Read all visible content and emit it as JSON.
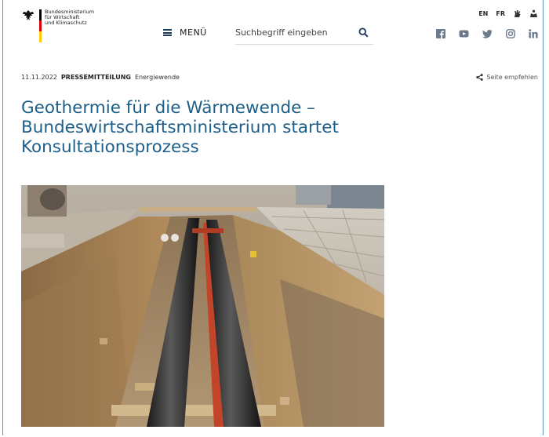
{
  "header": {
    "ministry_lines": [
      "Bundesministerium",
      "für Wirtschaft",
      "und Klimaschutz"
    ],
    "menu_label": "MENÜ",
    "search_placeholder": "Suchbegriff eingeben",
    "languages": [
      "EN",
      "FR"
    ],
    "accessibility_icons": [
      "sign-language-icon",
      "easy-language-icon"
    ],
    "social_icons": [
      "facebook-icon",
      "youtube-icon",
      "twitter-icon",
      "instagram-icon",
      "linkedin-icon"
    ]
  },
  "article": {
    "date": "11.11.2022",
    "type": "PRESSEMITTEILUNG",
    "category": "Energiewende",
    "share_label": "Seite empfehlen",
    "headline": "Geothermie für die Wärmewende – Bundeswirtschaftsministerium startet Konsultationsprozess"
  },
  "image": {
    "subject": "trench-with-district-heating-pipes"
  },
  "colors": {
    "headline": "#1e5f8a",
    "flag_black": "#000000",
    "flag_red": "#dd0000",
    "flag_gold": "#ffcc00",
    "icon_gray": "#6b7b8c"
  }
}
